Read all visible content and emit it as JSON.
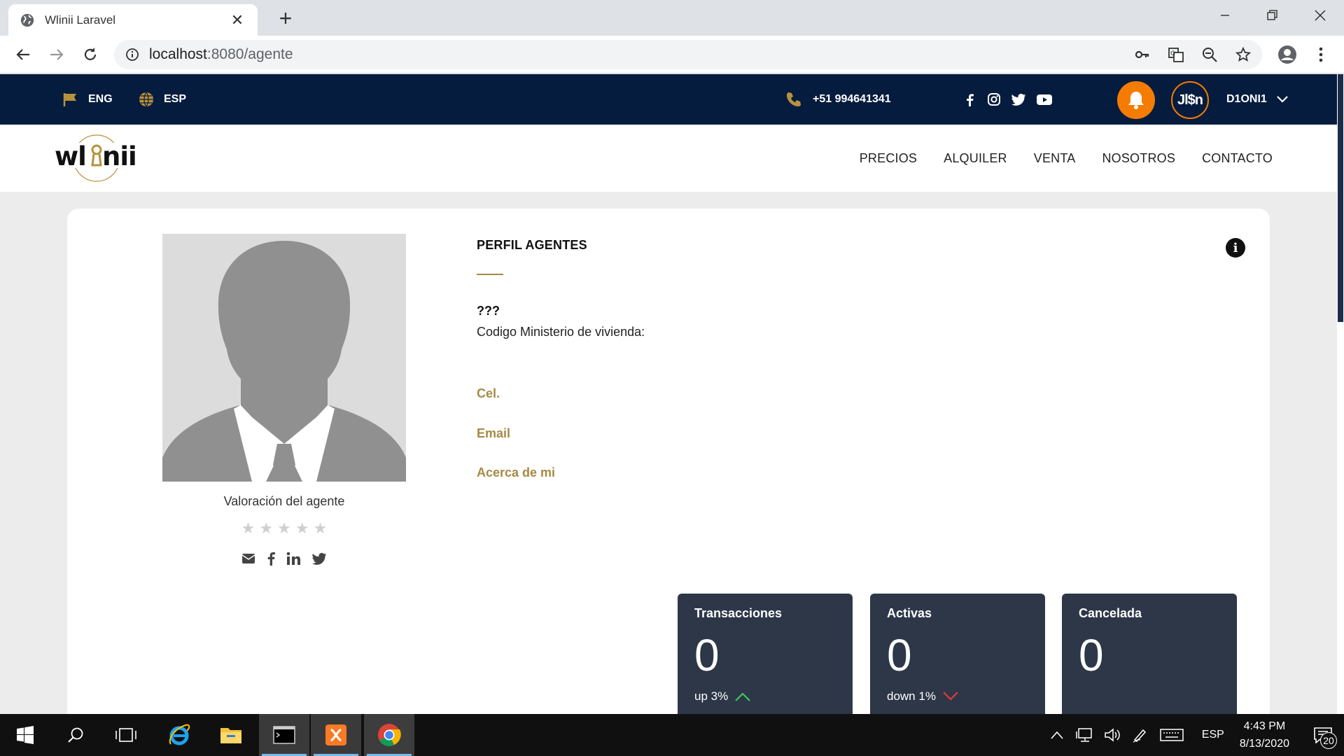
{
  "browser": {
    "tab_title": "Wlinii Laravel",
    "new_tab_label": "+",
    "close_label": "✕",
    "url_host": "localhost",
    "url_path": ":8080/agente"
  },
  "topbar": {
    "lang_eng": "ENG",
    "lang_esp": "ESP",
    "phone": "+51 994641341",
    "user_avatar_text": "Jl$n",
    "username": "D1ONI1"
  },
  "header": {
    "nav": [
      "PRECIOS",
      "ALQUILER",
      "VENTA",
      "NOSOTROS",
      "CONTACTO"
    ],
    "brand_color": "#a58a45"
  },
  "profile": {
    "title": "PERFIL AGENTES",
    "name": "???",
    "ministry_label": "Codigo Ministerio de vivienda:",
    "cel_label": "Cel.",
    "email_label": "Email",
    "about_label": "Acerca de mi",
    "rating_label": "Valoración del agente",
    "stars": 0,
    "stars_max": 5
  },
  "stats": [
    {
      "title": "Transacciones",
      "value": "0",
      "trend": "up 3%",
      "direction": "up"
    },
    {
      "title": "Activas",
      "value": "0",
      "trend": "down 1%",
      "direction": "down"
    },
    {
      "title": "Cancelada",
      "value": "0",
      "trend": "",
      "direction": ""
    }
  ],
  "taskbar": {
    "lang": "ESP",
    "time": "4:43 PM",
    "date": "8/13/2020",
    "notifications": "20"
  }
}
